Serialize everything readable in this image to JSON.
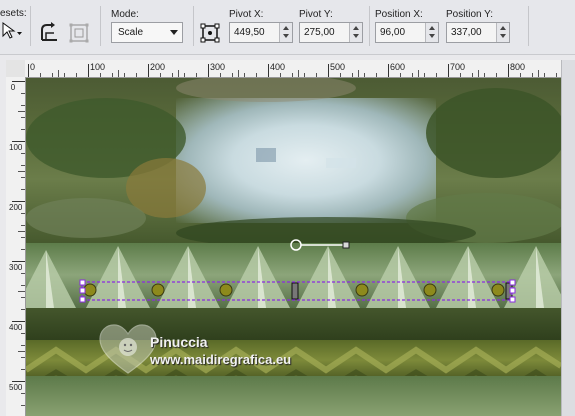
{
  "toolbar": {
    "presets_label": "esets:",
    "mode": {
      "label": "Mode:",
      "value": "Scale"
    },
    "pivot_x": {
      "label": "Pivot X:",
      "value": "449,50"
    },
    "pivot_y": {
      "label": "Pivot Y:",
      "value": "275,00"
    },
    "position_x": {
      "label": "Position X:",
      "value": "96,00"
    },
    "position_y": {
      "label": "Position Y:",
      "value": "337,00"
    }
  },
  "ruler": {
    "top_labels": [
      "0",
      "100",
      "200",
      "300",
      "400",
      "500",
      "600",
      "700",
      "800"
    ],
    "left_labels": [
      "0",
      "100",
      "200",
      "300",
      "400",
      "500"
    ]
  },
  "watermark": {
    "line1": "Pinuccia",
    "line2": "www.maidiregrafica.eu"
  },
  "colors": {
    "selection": "#8a2be2",
    "bead": "#8d8a1c"
  }
}
